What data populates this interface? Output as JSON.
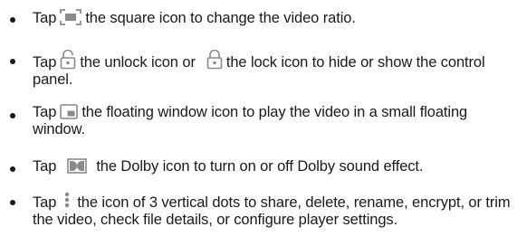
{
  "bullets": [
    {
      "tap": "Tap",
      "icon": "square-ratio-icon",
      "text": "the square icon to change the video ratio."
    },
    {
      "tap": "Tap",
      "icon": "unlock-icon",
      "text_a": "the unlock icon or",
      "icon_b": "lock-icon",
      "text_b": "the lock icon to hide or show the control panel."
    },
    {
      "tap": "Tap",
      "icon": "floating-window-icon",
      "text": "the floating window icon to play the video in a small floating window."
    },
    {
      "tap": "Tap",
      "icon": "dolby-icon",
      "text": "the Dolby icon to turn on or off Dolby sound effect."
    },
    {
      "tap": "Tap",
      "icon": "three-vertical-dots-icon",
      "text": "the icon of 3 vertical dots to share, delete, rename, encrypt, or trim the video, check file details, or configure player settings."
    }
  ],
  "colors": {
    "text": "#1a1a1a",
    "icon": "#8a8a8a"
  }
}
